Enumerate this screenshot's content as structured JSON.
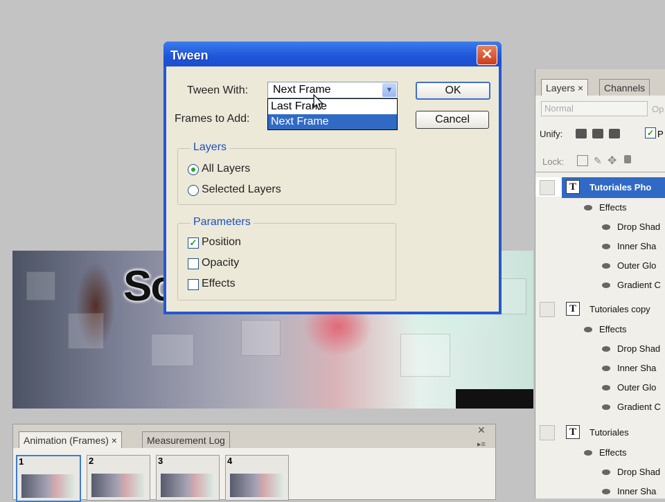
{
  "dialog": {
    "title": "Tween",
    "close_glyph": "✕",
    "tween_with_label": "Tween With:",
    "tween_with_value": "Next Frame",
    "tween_with_options": [
      "Last Frame",
      "Next Frame"
    ],
    "frames_to_add_label": "Frames to Add:",
    "ok_label": "OK",
    "cancel_label": "Cancel",
    "layers_group": {
      "title": "Layers",
      "all_layers": "All Layers",
      "selected_layers": "Selected Layers",
      "selected": "All Layers"
    },
    "parameters_group": {
      "title": "Parameters",
      "position": "Position",
      "opacity": "Opacity",
      "effects": "Effects",
      "position_checked": true,
      "opacity_checked": false,
      "effects_checked": false
    }
  },
  "canvas": {
    "text": "So"
  },
  "layers_panel": {
    "tabs": [
      "Layers ×",
      "Channels"
    ],
    "blend_mode": "Normal",
    "opacity_label": "Op",
    "unify_label": "Unify:",
    "lock_label": "Lock:",
    "propagate_label": "P",
    "rows": [
      {
        "type": "text",
        "name": "Tutoriales Pho",
        "selected": true
      },
      {
        "type": "fx",
        "name": "Effects"
      },
      {
        "type": "effect",
        "name": "Drop Shad"
      },
      {
        "type": "effect",
        "name": "Inner Sha"
      },
      {
        "type": "effect",
        "name": "Outer Glo"
      },
      {
        "type": "effect",
        "name": "Gradient C"
      },
      {
        "type": "text",
        "name": "Tutoriales copy"
      },
      {
        "type": "fx",
        "name": "Effects"
      },
      {
        "type": "effect",
        "name": "Drop Shad"
      },
      {
        "type": "effect",
        "name": "Inner Sha"
      },
      {
        "type": "effect",
        "name": "Outer Glo"
      },
      {
        "type": "effect",
        "name": "Gradient C"
      },
      {
        "type": "text",
        "name": "Tutoriales"
      },
      {
        "type": "fx",
        "name": "Effects"
      },
      {
        "type": "effect",
        "name": "Drop Shad"
      },
      {
        "type": "effect",
        "name": "Inner Sha"
      }
    ]
  },
  "animation_panel": {
    "tabs": [
      "Animation (Frames) ×",
      "Measurement Log"
    ],
    "frames": [
      "1",
      "2",
      "3",
      "4"
    ],
    "selected_frame": "1"
  }
}
